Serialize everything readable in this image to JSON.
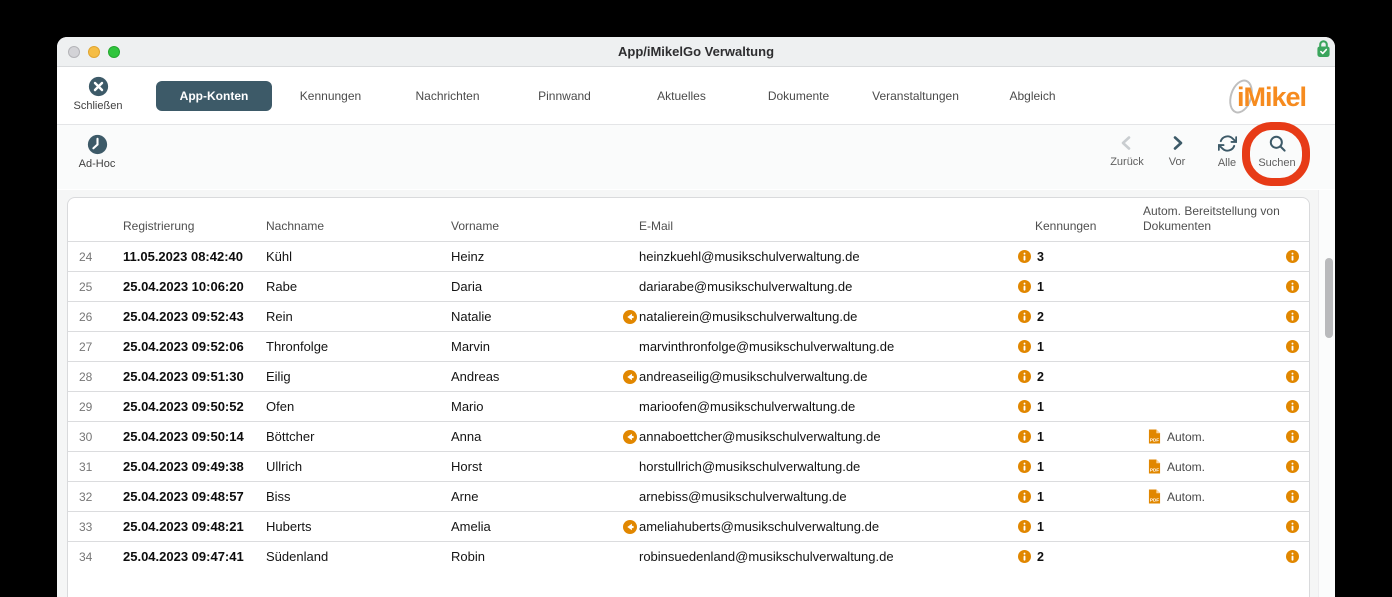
{
  "window": {
    "title": "App/iMikelGo Verwaltung"
  },
  "toolbar": {
    "close": {
      "label": "Schließen"
    },
    "tabs": [
      {
        "label": "App-Konten",
        "active": true
      },
      {
        "label": "Kennungen",
        "active": false
      },
      {
        "label": "Nachrichten",
        "active": false
      },
      {
        "label": "Pinnwand",
        "active": false
      },
      {
        "label": "Aktuelles",
        "active": false
      },
      {
        "label": "Dokumente",
        "active": false
      },
      {
        "label": "Veranstaltungen",
        "active": false
      },
      {
        "label": "Abgleich",
        "active": false
      }
    ],
    "logo": {
      "text": "iMikel"
    }
  },
  "subtoolbar": {
    "adhoc": {
      "label": "Ad-Hoc"
    },
    "nav": [
      {
        "label": "Zurück",
        "icon": "chevron-left",
        "disabled": true
      },
      {
        "label": "Vor",
        "icon": "chevron-right",
        "disabled": false
      },
      {
        "label": "Alle",
        "icon": "refresh",
        "disabled": false
      },
      {
        "label": "Suchen",
        "icon": "search",
        "disabled": false,
        "highlighted": true
      }
    ],
    "annotation": {
      "target": "Suchen",
      "shape": "circle",
      "color": "#e73b17"
    }
  },
  "table": {
    "headers": {
      "registrierung": "Registrierung",
      "nachname": "Nachname",
      "vorname": "Vorname",
      "email": "E-Mail",
      "kennungen": "Kennungen",
      "autom": "Autom. Bereitstellung von Dokumenten"
    },
    "autom_label": "Autom.",
    "rows": [
      {
        "num": "24",
        "registrierung": "11.05.2023 08:42:40",
        "nachname": "Kühl",
        "vorname": "Heinz",
        "email": "heinzkuehl@musikschulverwaltung.de",
        "email_forward_icon": false,
        "kennungen": "3",
        "autom": false
      },
      {
        "num": "25",
        "registrierung": "25.04.2023 10:06:20",
        "nachname": "Rabe",
        "vorname": "Daria",
        "email": "dariarabe@musikschulverwaltung.de",
        "email_forward_icon": false,
        "kennungen": "1",
        "autom": false
      },
      {
        "num": "26",
        "registrierung": "25.04.2023 09:52:43",
        "nachname": "Rein",
        "vorname": "Natalie",
        "email": "natalierein@musikschulverwaltung.de",
        "email_forward_icon": true,
        "kennungen": "2",
        "autom": false
      },
      {
        "num": "27",
        "registrierung": "25.04.2023 09:52:06",
        "nachname": "Thronfolge",
        "vorname": "Marvin",
        "email": "marvinthronfolge@musikschulverwaltung.de",
        "email_forward_icon": false,
        "kennungen": "1",
        "autom": false
      },
      {
        "num": "28",
        "registrierung": "25.04.2023 09:51:30",
        "nachname": "Eilig",
        "vorname": "Andreas",
        "email": "andreaseilig@musikschulverwaltung.de",
        "email_forward_icon": true,
        "kennungen": "2",
        "autom": false
      },
      {
        "num": "29",
        "registrierung": "25.04.2023 09:50:52",
        "nachname": "Ofen",
        "vorname": "Mario",
        "email": "marioofen@musikschulverwaltung.de",
        "email_forward_icon": false,
        "kennungen": "1",
        "autom": false
      },
      {
        "num": "30",
        "registrierung": "25.04.2023 09:50:14",
        "nachname": "Böttcher",
        "vorname": "Anna",
        "email": "annaboettcher@musikschulverwaltung.de",
        "email_forward_icon": true,
        "kennungen": "1",
        "autom": true
      },
      {
        "num": "31",
        "registrierung": "25.04.2023 09:49:38",
        "nachname": "Ullrich",
        "vorname": "Horst",
        "email": "horstullrich@musikschulverwaltung.de",
        "email_forward_icon": false,
        "kennungen": "1",
        "autom": true
      },
      {
        "num": "32",
        "registrierung": "25.04.2023 09:48:57",
        "nachname": "Biss",
        "vorname": "Arne",
        "email": "arnebiss@musikschulverwaltung.de",
        "email_forward_icon": false,
        "kennungen": "1",
        "autom": true
      },
      {
        "num": "33",
        "registrierung": "25.04.2023 09:48:21",
        "nachname": "Huberts",
        "vorname": "Amelia",
        "email": "ameliahuberts@musikschulverwaltung.de",
        "email_forward_icon": true,
        "kennungen": "1",
        "autom": false
      },
      {
        "num": "34",
        "registrierung": "25.04.2023 09:47:41",
        "nachname": "Südenland",
        "vorname": "Robin",
        "email": "robinsuedenland@musikschulverwaltung.de",
        "email_forward_icon": false,
        "kennungen": "2",
        "autom": false
      }
    ]
  },
  "colors": {
    "accent_slate": "#3d5a68",
    "accent_orange": "#e18700",
    "logo_orange": "#f68b1f",
    "annotation_red": "#e73b17",
    "lock_green": "#3ba55d"
  }
}
